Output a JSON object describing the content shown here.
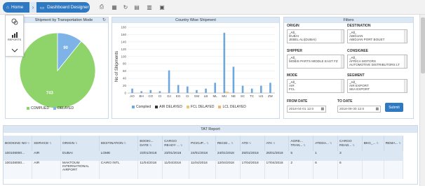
{
  "breadcrumb": {
    "home": "Home",
    "separator": "›",
    "current": "Dashboard Designer"
  },
  "sidebar": {
    "reports_label": "REPORTS"
  },
  "pie": {
    "title": "Shipment by Transportation Mode",
    "label_large": "743",
    "label_small": "90",
    "legend": [
      "COMPLIED",
      "DELAYED"
    ],
    "colors": {
      "complied": "#8fd46b",
      "delayed": "#7eb3e8"
    }
  },
  "country_chart": {
    "title": "Country Wise Shipment",
    "ylabel": "No of Shipments",
    "legend": [
      "Complied",
      "AIR DELAYED",
      "FCL DELAYED",
      "LCL DELAYED"
    ],
    "legend_colors": [
      "#6fa8dc",
      "#333333",
      "#f0c674",
      "#f6b26b"
    ]
  },
  "chart_data": [
    {
      "type": "pie",
      "title": "Shipment by Transportation Mode",
      "categories": [
        "COMPLIED",
        "DELAYED"
      ],
      "values": [
        743,
        90
      ]
    },
    {
      "type": "bar",
      "title": "Country Wise Shipment",
      "ylabel": "No of Shipments",
      "categories": [
        "AO",
        "BH",
        "CO",
        "CI",
        "DJ",
        "EG",
        "CI",
        "GM",
        "LB",
        "ML",
        "MU",
        "NE",
        "SC",
        "TC",
        "US",
        "ZW"
      ],
      "series": [
        {
          "name": "Complied",
          "values": [
            12,
            5,
            8,
            5,
            62,
            22,
            18,
            8,
            12,
            28,
            165,
            72,
            20,
            12,
            20,
            28
          ]
        },
        {
          "name": "FCL DELAYED",
          "values": [
            0,
            0,
            0,
            0,
            0,
            0,
            0,
            0,
            0,
            0,
            4,
            0,
            0,
            0,
            0,
            0
          ]
        },
        {
          "name": "LCL DELAYED",
          "values": [
            0,
            0,
            0,
            0,
            0,
            0,
            0,
            0,
            0,
            0,
            3,
            0,
            0,
            0,
            0,
            0
          ]
        }
      ],
      "yticks": [
        0,
        20,
        40,
        60,
        80,
        100,
        120,
        140,
        160,
        180
      ],
      "ylim": [
        0,
        180
      ]
    }
  ],
  "filters": {
    "title": "Filters",
    "origin_label": "ORIGIN",
    "origin_items": [
      "_All_",
      "DUBAI",
      "JEBEL ALI(DUBAI)"
    ],
    "destination_label": "DESTINATION",
    "destination_items": [
      "_All_",
      "ABIDJAN",
      "ABIDJAN PORT BOUET"
    ],
    "shipper_label": "SHIPPER",
    "shipper_items": [
      "_All_",
      "MOBIS PARTS MIDDLE EAST FZ"
    ],
    "consignee_label": "CONSIGNEE",
    "consignee_items": [
      "_All_",
      "AFRICA MOTORS",
      "AUTOMOTIVE DISTRIBUTORS LT"
    ],
    "mode_label": "MODE",
    "mode_items": [
      "_All_",
      "AIR",
      "FCL"
    ],
    "segment_label": "SEGMENT",
    "segment_items": [
      "_All_",
      "AIR EXPORT",
      "SEA EXPORT"
    ],
    "from_label": "FROM DATE",
    "from_value": "2018-04-01 12:0",
    "to_label": "TO DATE",
    "to_value": "2018-09-30 12:0",
    "submit": "Submit"
  },
  "tat": {
    "title": "TAT Report",
    "headers": [
      "BOOKING NO",
      "SERVICE",
      "ORIGIN",
      "DESTINATION",
      "BOOKI... DATE",
      "CARGO READY ...",
      "PICKUP...",
      "RECEI...",
      "ATD",
      "ATA",
      "AGRE... TRAN...",
      "ATDDA...",
      "CARGO READ...",
      "BKG_...",
      "REMA..."
    ],
    "rows": [
      [
        "100108000...",
        "AIR",
        "DUBAI",
        "LOME",
        "23/01/2018",
        "23/01/2018",
        "24/01/2018",
        "24/01/2018",
        "25/01/2018",
        "26/01/2018",
        "5",
        "1",
        "3",
        "",
        ""
      ],
      [
        "100108000...",
        "AIR",
        "MAKTOUM INTERNATIONAL AIRPORT",
        "CAIRO INTL",
        "11/04/2018",
        "11/04/2018",
        "11/04/2018",
        "12/04/2018",
        "17/04/2018",
        "17/04/2018",
        "2",
        "6",
        "6",
        "",
        ""
      ]
    ]
  }
}
